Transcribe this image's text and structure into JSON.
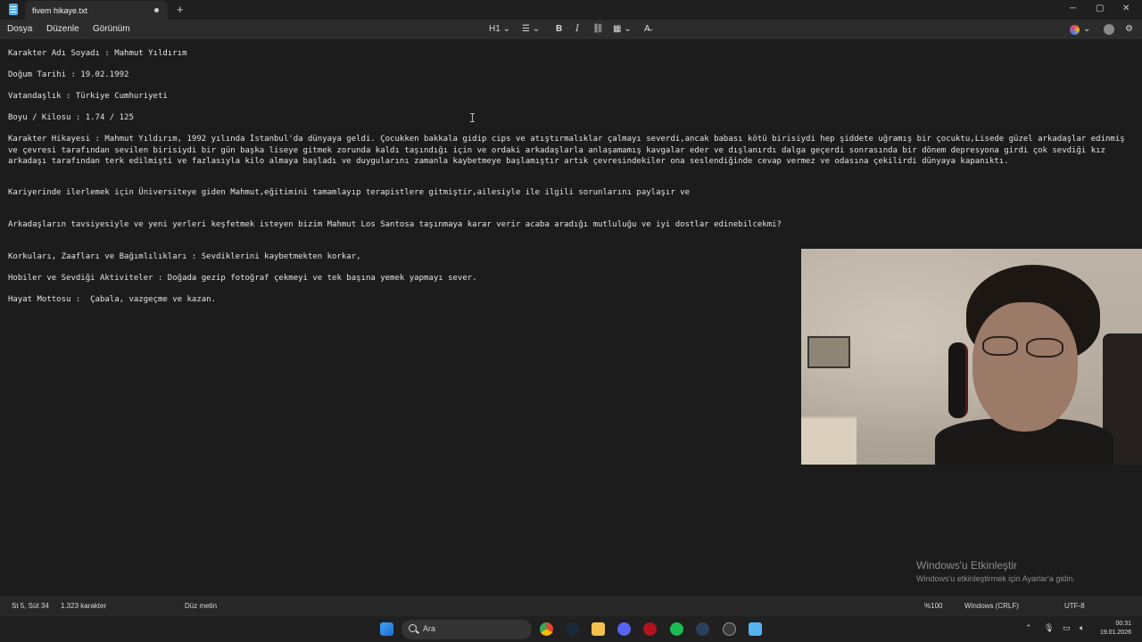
{
  "titlebar": {
    "tab_title": "fivem hikaye.txt",
    "add_tab": "+",
    "minimize": "─",
    "maximize": "▢",
    "close": "✕"
  },
  "menu": {
    "file": "Dosya",
    "edit": "Düzenle",
    "view": "Görünüm",
    "heading": "H1",
    "list": "☰",
    "bold": "B",
    "italic": "I",
    "link": "⛓",
    "table": "▦",
    "clear": "A̶"
  },
  "document": {
    "lines": [
      "Karakter Adı Soyadı : Mahmut Yıldırım",
      "Doğum Tarihi : 19.02.1992",
      "Vatandaşlık : Türkiye Cumhuriyeti",
      "Boyu / Kilosu : 1.74 / 125",
      "Karakter Hikayesi : Mahmut Yıldırım, 1992 yılında İstanbul'da dünyaya geldi. Çocukken bakkala gidip cips ve atıştırmalıklar çalmayı severdi,ancak babası kötü birisiydi hep şiddete uğramış bir çocuktu,Lisede güzel arkadaşlar edinmiş ve çevresi tarafından sevilen birisiydi bir gün başka liseye gitmek zorunda kaldı taşındığı için ve ordaki arkadaşlarla anlaşamamış kavgalar eder ve dışlanırdı dalga geçerdi sonrasında bir dönem depresyona girdi çok sevdiği kız arkadaşı tarafından terk edilmişti ve fazlasıyla kilo almaya başladı ve duygularını zamanla kaybetmeye başlamıştır artık çevresindekiler ona seslendiğinde cevap vermez ve odasına çekilirdi dünyaya kapanıktı.",
      "Kariyerinde ilerlemek için Üniversiteye giden Mahmut,eğitimini tamamlayıp terapistlere gitmiştir,ailesiyle ile ilgili sorunlarını paylaşır ve",
      "Arkadaşların tavsiyesiyle ve yeni yerleri keşfetmek isteyen bizim Mahmut Los Santosa taşınmaya karar verir acaba aradığı mutluluğu ve iyi dostlar edinebilcekmi?",
      "Korkuları, Zaafları ve Bağımlılıkları : Sevdiklerini kaybetmekten korkar,",
      "Hobiler ve Sevdiği Aktiviteler : Doğada gezip fotoğraf çekmeyi ve tek başına yemek yapmayı sever.",
      "Hayat Mottosu :  Çabala, vazgeçme ve kazan."
    ]
  },
  "watermark": {
    "title": "Windows'u Etkinleştir",
    "subtitle": "Windows'u etkinleştirmek için Ayarlar'a gidin."
  },
  "status": {
    "position": "St 5, Süt 34",
    "chars": "1.323 karakter",
    "mode": "Düz metin",
    "zoom": "%100",
    "eol": "Windows (CRLF)",
    "encoding": "UTF-8"
  },
  "taskbar": {
    "search_placeholder": "Ara",
    "time": "00:31",
    "date": "19.01.2026"
  },
  "colors": {
    "accent_blue": "#55b3f0",
    "editor_bg": "#1c1c1c"
  }
}
